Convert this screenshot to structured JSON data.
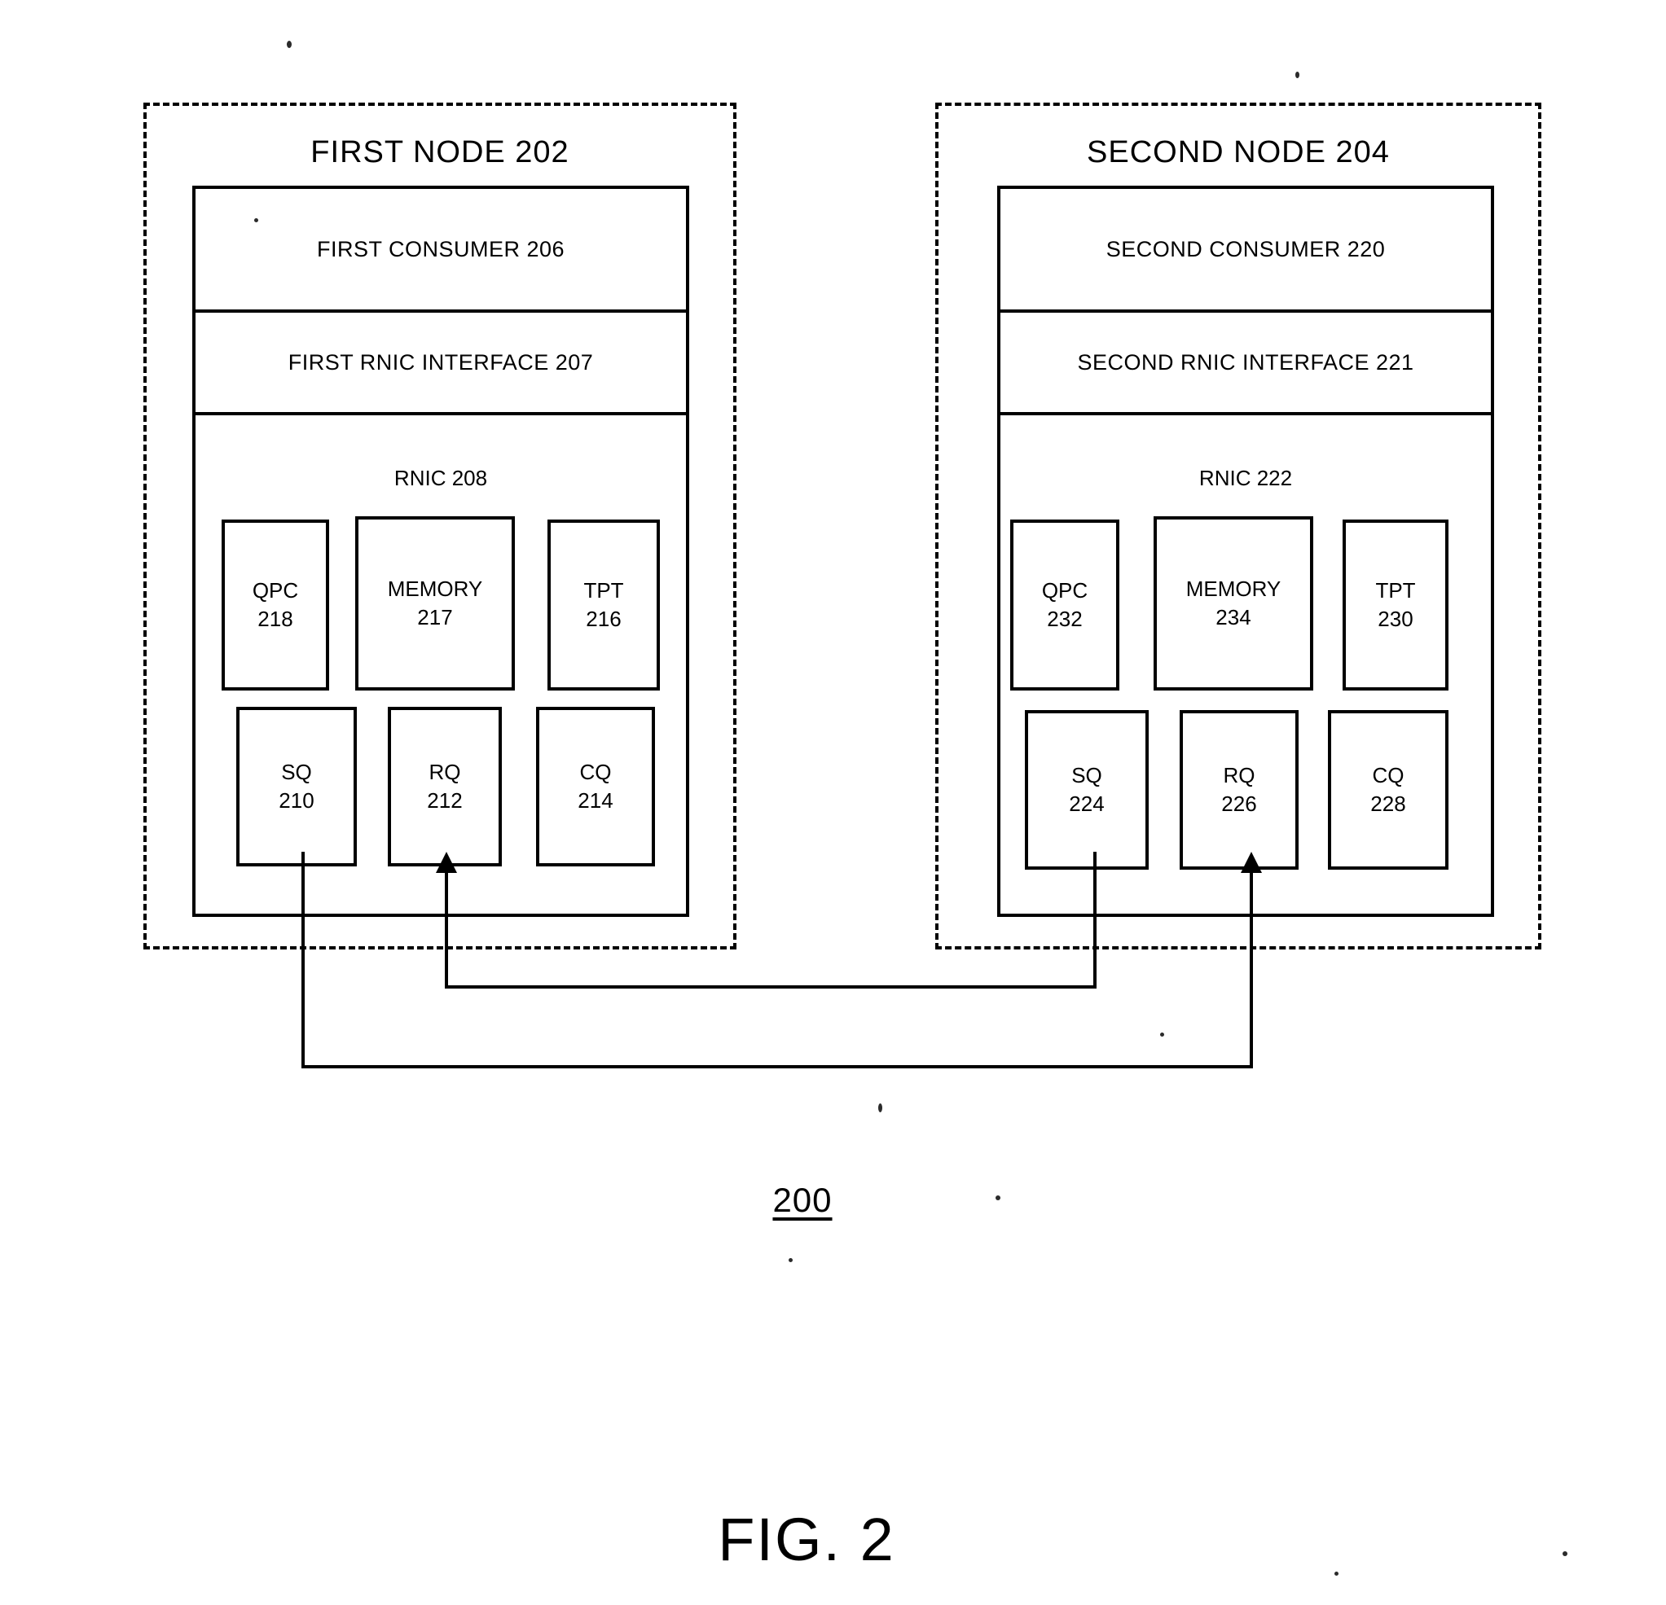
{
  "figure": {
    "number_label": "200",
    "caption": "FIG. 2"
  },
  "nodes": [
    {
      "id": "first-node",
      "title": "FIRST NODE 202",
      "consumer": "FIRST CONSUMER 206",
      "interface": "FIRST RNIC INTERFACE 207",
      "rnic_label": "RNIC 208",
      "components": [
        {
          "name": "QPC",
          "num": "218"
        },
        {
          "name": "MEMORY",
          "num": "217"
        },
        {
          "name": "TPT",
          "num": "216"
        },
        {
          "name": "SQ",
          "num": "210"
        },
        {
          "name": "RQ",
          "num": "212"
        },
        {
          "name": "CQ",
          "num": "214"
        }
      ]
    },
    {
      "id": "second-node",
      "title": "SECOND NODE 204",
      "consumer": "SECOND CONSUMER 220",
      "interface": "SECOND RNIC INTERFACE 221",
      "rnic_label": "RNIC 222",
      "components": [
        {
          "name": "QPC",
          "num": "232"
        },
        {
          "name": "MEMORY",
          "num": "234"
        },
        {
          "name": "TPT",
          "num": "230"
        },
        {
          "name": "SQ",
          "num": "224"
        },
        {
          "name": "RQ",
          "num": "226"
        },
        {
          "name": "CQ",
          "num": "228"
        }
      ]
    }
  ],
  "connections": [
    {
      "from": "SQ 210",
      "to": "RQ 226"
    },
    {
      "from": "SQ 224",
      "to": "RQ 212"
    }
  ],
  "colors": {
    "ink": "#000000",
    "paper": "#ffffff"
  }
}
